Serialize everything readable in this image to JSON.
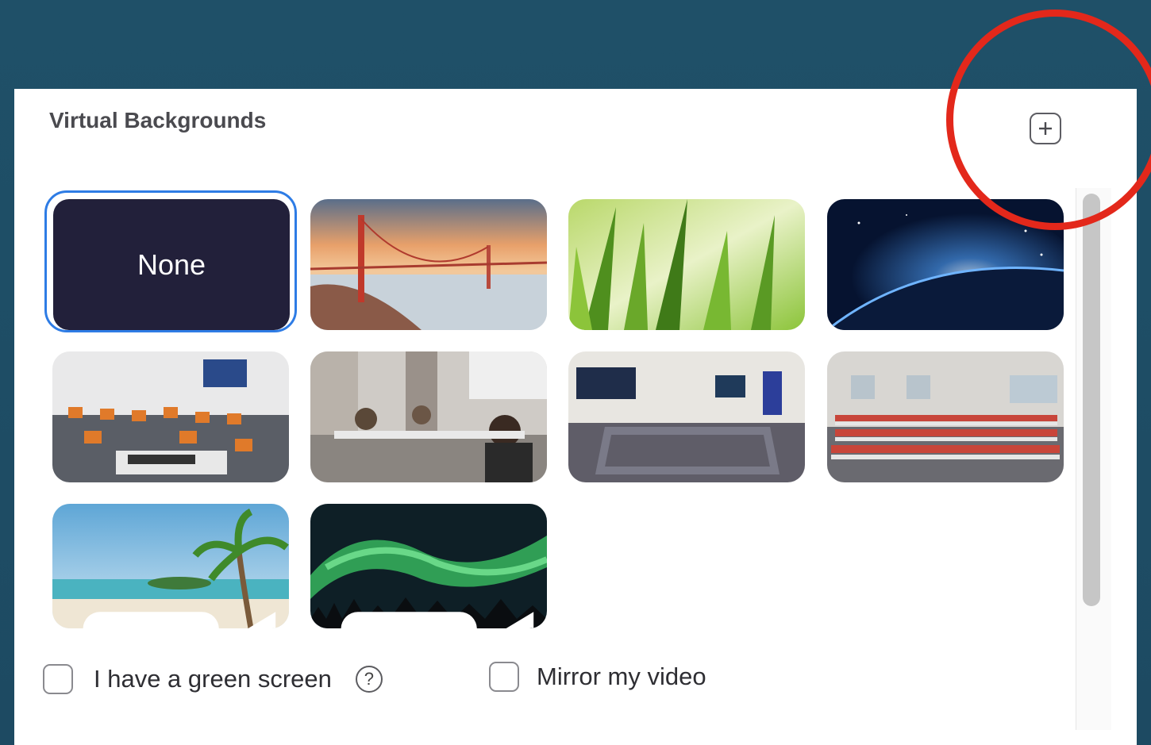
{
  "section_title": "Virtual Backgrounds",
  "add_button_icon": "plus-square-icon",
  "none_label": "None",
  "backgrounds": [
    {
      "name": "golden-gate-bridge"
    },
    {
      "name": "grass"
    },
    {
      "name": "earth-from-space"
    },
    {
      "name": "classroom-orange-chairs"
    },
    {
      "name": "office-people"
    },
    {
      "name": "conference-room-u-shape"
    },
    {
      "name": "lecture-hall-red-chairs"
    },
    {
      "name": "tropical-beach",
      "video": true
    },
    {
      "name": "aurora-borealis",
      "video": true
    }
  ],
  "options": {
    "green_screen_label": "I have a green screen",
    "mirror_label": "Mirror my video"
  },
  "colors": {
    "selected_border": "#2e7ce5",
    "annotation": "#e3281b"
  }
}
